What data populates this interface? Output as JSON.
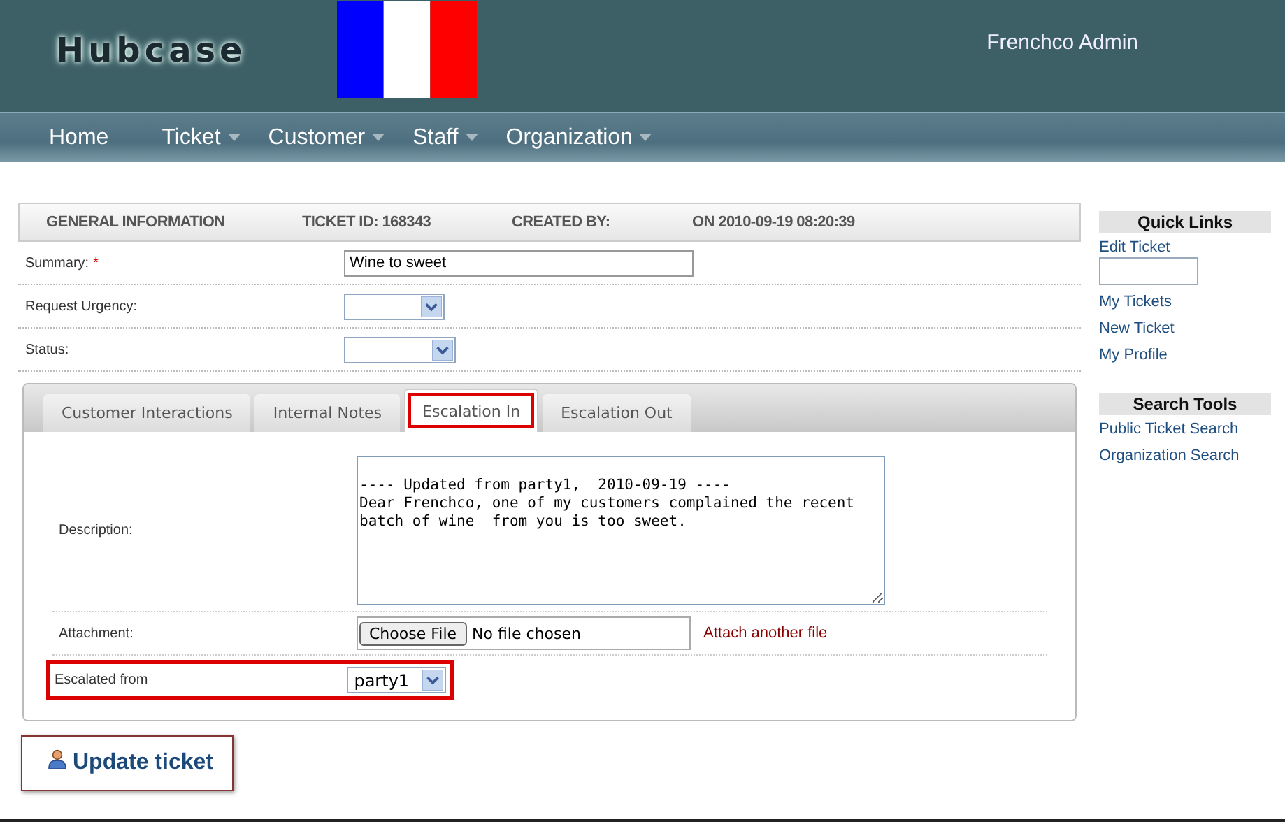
{
  "header": {
    "logo": "Hubcase",
    "user": "Frenchco Admin"
  },
  "nav": [
    {
      "label": "Home",
      "dropdown": false
    },
    {
      "label": "Ticket",
      "dropdown": true
    },
    {
      "label": "Customer",
      "dropdown": true
    },
    {
      "label": "Staff",
      "dropdown": true
    },
    {
      "label": "Organization",
      "dropdown": true
    }
  ],
  "info_bar": [
    "GENERAL INFORMATION",
    "TICKET ID: 168343",
    "CREATED BY:",
    "ON 2010-09-19 08:20:39"
  ],
  "fields": [
    {
      "kind": "text",
      "label": "Summary:",
      "required_mark": "*",
      "value": "Wine to sweet"
    },
    {
      "kind": "select",
      "label": "Request Urgency:"
    },
    {
      "kind": "select",
      "label": "Status:"
    }
  ],
  "tabs": [
    {
      "label": "Customer Interactions",
      "selected": false,
      "highlighted": false
    },
    {
      "label": "Internal Notes",
      "selected": false,
      "highlighted": false
    },
    {
      "label": "Escalation In",
      "selected": true,
      "highlighted": true
    },
    {
      "label": "Escalation Out",
      "selected": false,
      "highlighted": false
    }
  ],
  "tab_fields": [
    {
      "kind": "textarea",
      "label": "Description:",
      "value": "---- Updated from party1,  2010-09-19 ----\nDear Frenchco, one of my customers complained the recent\nbatch of wine  from you is too sweet.",
      "highlighted": false
    },
    {
      "kind": "file",
      "label": "Attachment:",
      "button": "Choose File",
      "value": "No file chosen",
      "link": "Attach another file",
      "highlighted": false
    },
    {
      "kind": "select",
      "label": "Escalated from",
      "value": "party1",
      "highlighted": true
    }
  ],
  "update_button": "Update ticket",
  "sidebar": [
    {
      "title": "Quick Links",
      "items": [
        {
          "kind": "link",
          "label": "Edit Ticket"
        },
        {
          "kind": "input"
        },
        {
          "kind": "link",
          "label": "My Tickets"
        },
        {
          "kind": "link",
          "label": "New Ticket"
        },
        {
          "kind": "link",
          "label": "My Profile"
        }
      ]
    },
    {
      "title": "Search Tools",
      "items": [
        {
          "kind": "link",
          "label": "Public Ticket Search"
        },
        {
          "kind": "link",
          "label": "Organization Search"
        }
      ]
    }
  ]
}
